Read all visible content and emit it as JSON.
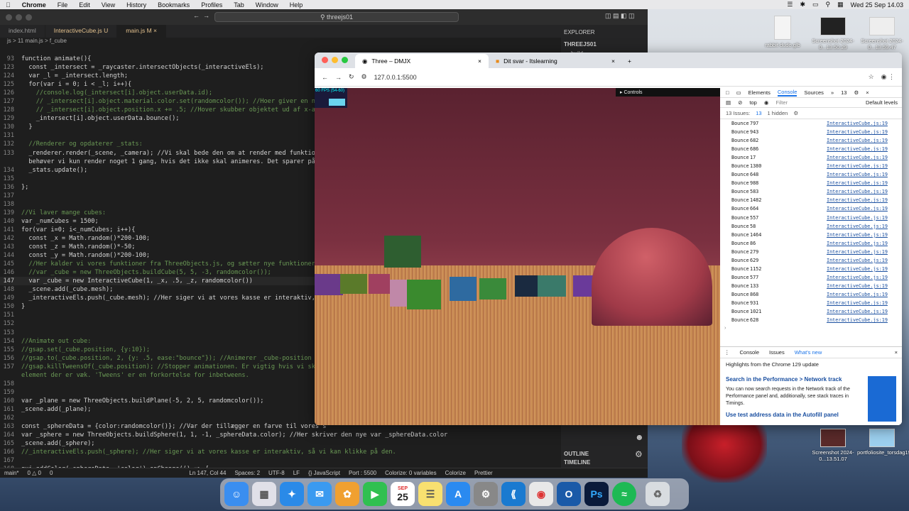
{
  "menubar": {
    "app": "Chrome",
    "items": [
      "File",
      "Edit",
      "View",
      "History",
      "Bookmarks",
      "Profiles",
      "Tab",
      "Window",
      "Help"
    ],
    "datetime": "Wed 25 Sep 14.03"
  },
  "vscode": {
    "search": "threejs01",
    "tabs": [
      {
        "label": "index.html",
        "active": false
      },
      {
        "label": "InteractiveCube.js U",
        "active": false
      },
      {
        "label": "main.js M",
        "active": true
      }
    ],
    "breadcrumb": "js > 11 main.js > f_cube",
    "explorer_title": "EXPLORER",
    "explorer_project": "THREEJS01",
    "explorer_item": "build",
    "outline": "OUTLINE",
    "timeline": "TIMELINE",
    "code": [
      {
        "n": "93",
        "t": "function animate(){"
      },
      {
        "n": "123",
        "t": "  const _intersect = _raycaster.intersectObjects(_interactiveEls);"
      },
      {
        "n": "124",
        "t": "  var _l = _intersect.length;"
      },
      {
        "n": "125",
        "t": "  for(var i = 0; i < _l; i++){"
      },
      {
        "n": "126",
        "t": "    //console.log(_intersect[i].object.userData.id);",
        "c": true
      },
      {
        "n": "127",
        "t": "    // _intersect[i].object.material.color.set(randomcolor()); //Hoer giver en ny r",
        "c": true
      },
      {
        "n": "128",
        "t": "    // _intersect[i].object.position.x += .5; //Hover skubber objektet ud af x-aksen.",
        "c": true
      },
      {
        "n": "129",
        "t": "    _intersect[i].object.userData.bounce();"
      },
      {
        "n": "130",
        "t": "  }"
      },
      {
        "n": "131",
        "t": ""
      },
      {
        "n": "132",
        "t": "  //Renderer og opdaterer _stats:",
        "c": true
      },
      {
        "n": "133",
        "t": "  _renderer.render(_scene, _camera); //Vi skal bede den om at render med funktion,"
      },
      {
        "n": "",
        "t": "  behøver vi kun render noget 1 gang, hvis det ikke skal animeres. Det sparer på pe"
      },
      {
        "n": "134",
        "t": "  _stats.update();"
      },
      {
        "n": "135",
        "t": ""
      },
      {
        "n": "136",
        "t": "};"
      },
      {
        "n": "137",
        "t": ""
      },
      {
        "n": "138",
        "t": ""
      },
      {
        "n": "139",
        "t": "//Vi laver mange cubes:",
        "c": true
      },
      {
        "n": "140",
        "t": "var _numCubes = 1500;"
      },
      {
        "n": "141",
        "t": "for(var i=0; i<_numCubes; i++){"
      },
      {
        "n": "142",
        "t": "  const _x = Math.random()*200-100;"
      },
      {
        "n": "143",
        "t": "  const _z = Math.random()*-50;"
      },
      {
        "n": "144",
        "t": "  const _y = Math.random()*200-100;"
      },
      {
        "n": "145",
        "t": "  //Her kalder vi vores funktioner fra ThreeObjects.js, og sætter nye funktioner in",
        "c": true
      },
      {
        "n": "146",
        "t": "  //var _cube = new ThreeObjects.buildCube(5, 5, -3, randomcolor());",
        "c": true
      },
      {
        "n": "147",
        "t": "  var _cube = new InteractiveCube(1, _x, .5, _z, randomcolor())",
        "cur": true
      },
      {
        "n": "148",
        "t": "  _scene.add(_cube.mesh);"
      },
      {
        "n": "149",
        "t": "  _interactiveEls.push(_cube.mesh); //Her siger vi at vores kasse er interaktiv, så"
      },
      {
        "n": "150",
        "t": "}"
      },
      {
        "n": "151",
        "t": ""
      },
      {
        "n": "152",
        "t": ""
      },
      {
        "n": "153",
        "t": ""
      },
      {
        "n": "154",
        "t": "//Animate out cube:",
        "c": true
      },
      {
        "n": "155",
        "t": "//gsap.set(_cube.position, {y:10});",
        "c": true
      },
      {
        "n": "156",
        "t": "//gsap.to(_cube.position, 2, {y: .5, ease:\"bounce\"}); //Animerer _cube-position med",
        "c": true
      },
      {
        "n": "157",
        "t": "//gsap.killTweensOf(_cube.position); //Stopper animationen. Er vigtig hvis vi skif",
        "c": true
      },
      {
        "n": "",
        "t": "element der er væk. 'Tweens' er en forkortelse for inbetweens.",
        "c": true
      },
      {
        "n": "158",
        "t": ""
      },
      {
        "n": "159",
        "t": ""
      },
      {
        "n": "160",
        "t": "var _plane = new ThreeObjects.buildPlane(-5, 2, 5, randomcolor());"
      },
      {
        "n": "161",
        "t": "_scene.add(_plane);"
      },
      {
        "n": "162",
        "t": ""
      },
      {
        "n": "163",
        "t": "const _sphereData = {color:randomcolor()}; //Var der tillægger en farve til vores s"
      },
      {
        "n": "164",
        "t": "var _sphere = new ThreeObjects.buildSphere(1, 1, -1, _sphereData.color); //Her skriver den nye var _sphereData.color"
      },
      {
        "n": "165",
        "t": "_scene.add(_sphere);"
      },
      {
        "n": "166",
        "t": "//_interactiveEls.push(_sphere); //Her siger vi at vores kasse er interaktiv, så vi kan klikke på den.",
        "c": true
      },
      {
        "n": "167",
        "t": ""
      },
      {
        "n": "168",
        "t": "gui.addColor(_sphereData, 'color').onChange(() => {"
      }
    ],
    "status": [
      "main*",
      "0 △ 0",
      "0",
      "Ln 147, Col 44",
      "Spaces: 2",
      "UTF-8",
      "LF",
      "{} JavaScript",
      "Port : 5500",
      "Colorize: 0 variables",
      "Colorize",
      "Prettier"
    ]
  },
  "browser": {
    "tabs": [
      {
        "label": "Three – DMJX",
        "active": true
      },
      {
        "label": "Dit svar - Itslearning",
        "active": false
      }
    ],
    "url": "127.0.0.1:5500",
    "fps": "60 FPS (54-60)",
    "controls": "Controls"
  },
  "devtools": {
    "tabs": [
      "Elements",
      "Console",
      "Sources"
    ],
    "issue_count": "13",
    "context": "top",
    "filter_placeholder": "Filter",
    "levels": "Default levels",
    "issues_label": "13 Issues:",
    "issues_count": "13",
    "hidden": "1 hidden",
    "logs": [
      {
        "v": "797"
      },
      {
        "v": "943"
      },
      {
        "v": "682"
      },
      {
        "v": "686"
      },
      {
        "v": "17"
      },
      {
        "v": "1380"
      },
      {
        "v": "648"
      },
      {
        "v": "988"
      },
      {
        "v": "583"
      },
      {
        "v": "1482"
      },
      {
        "v": "664"
      },
      {
        "v": "557"
      },
      {
        "v": "58"
      },
      {
        "v": "1464"
      },
      {
        "v": "86"
      },
      {
        "v": "279"
      },
      {
        "v": "629"
      },
      {
        "v": "1152"
      },
      {
        "v": "577"
      },
      {
        "v": "133"
      },
      {
        "v": "868"
      },
      {
        "v": "931"
      },
      {
        "v": "1021"
      },
      {
        "v": "628"
      }
    ],
    "log_label": "Bounce",
    "log_source": "InteractiveCube.js:19",
    "drawer_tabs": [
      "Console",
      "Issues",
      "What's new"
    ],
    "drawer_highlight": "Highlights from the Chrome 129 update",
    "drawer_h1": "Search in the Performance > Network track",
    "drawer_p1": "You can now search requests in the Network track of the Performance panel and, additionally, see stack traces in Timings.",
    "drawer_h2": "Use test address data in the Autofill panel"
  },
  "desktop_files": [
    {
      "label": "rabbit dudo.glb"
    },
    {
      "label": "Screenshot 2024-0...13.50.29"
    },
    {
      "label": "Screenshot 2024-0...13.59.47"
    },
    {
      "label": "Screenshot 2024-0...13.51.07"
    },
    {
      "label": "portfoliosite_torsdag19_9_24"
    }
  ],
  "dock": {
    "calendar_month": "SEP",
    "calendar_day": "25"
  }
}
